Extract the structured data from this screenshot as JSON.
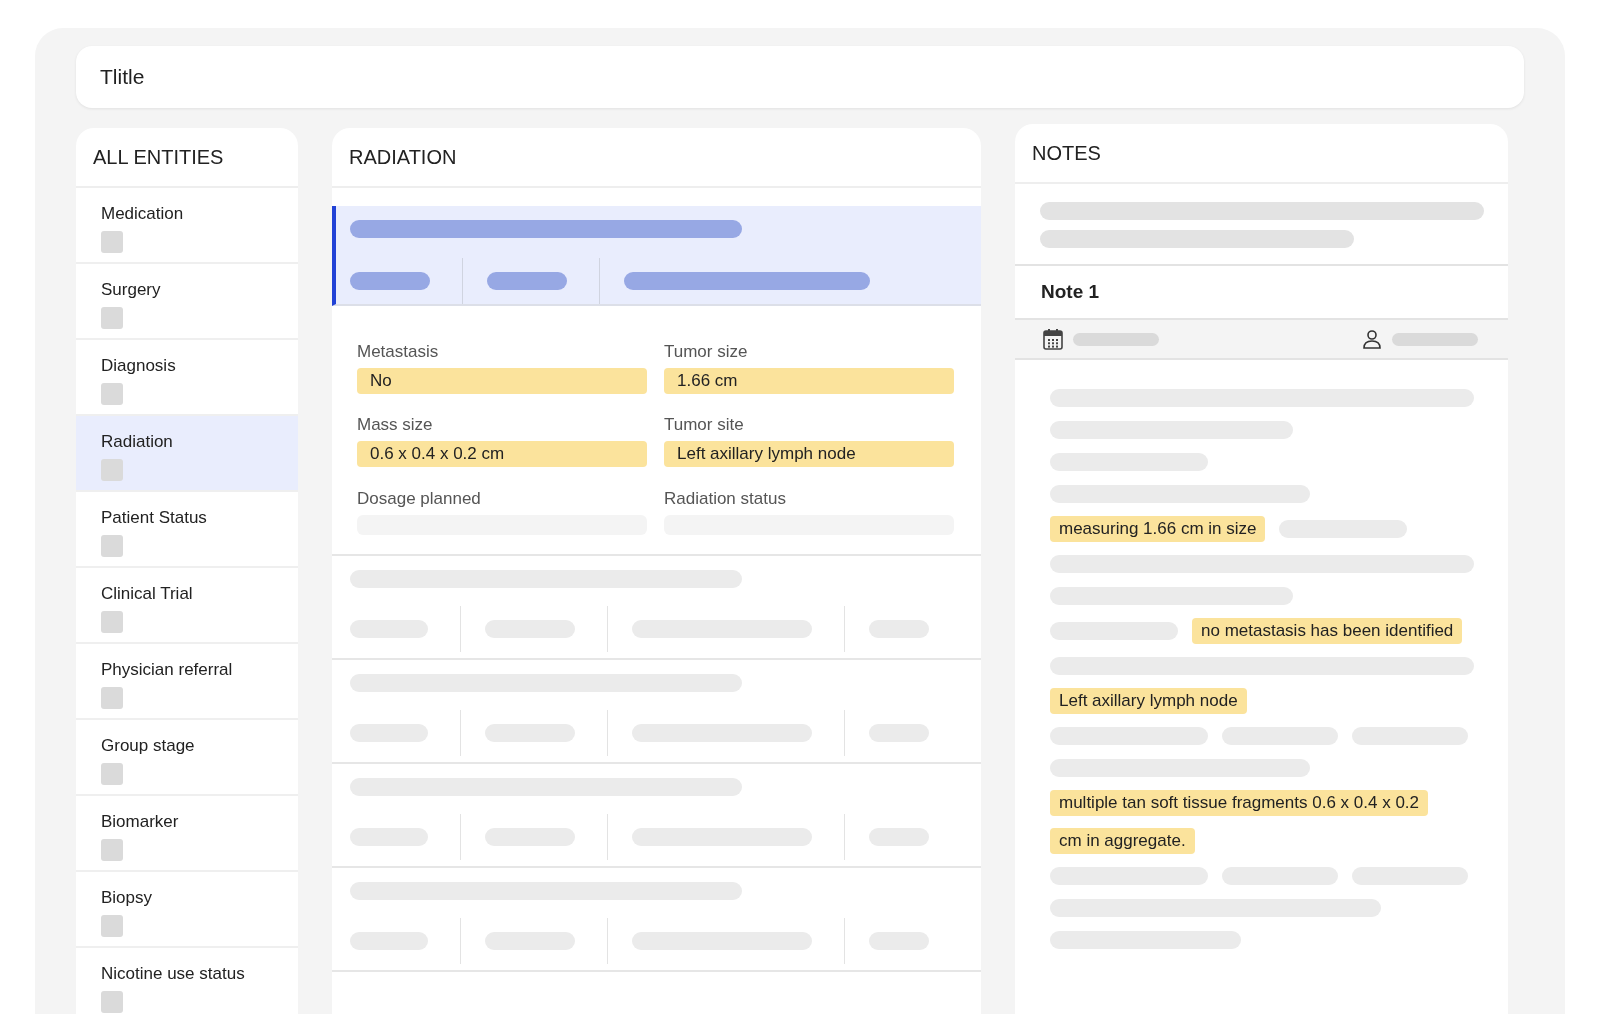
{
  "title": "Tlitle",
  "sidebar": {
    "heading": "ALL ENTITIES",
    "items": [
      {
        "label": "Medication",
        "selected": false
      },
      {
        "label": "Surgery",
        "selected": false
      },
      {
        "label": "Diagnosis",
        "selected": false
      },
      {
        "label": "Radiation",
        "selected": true
      },
      {
        "label": "Patient Status",
        "selected": false
      },
      {
        "label": "Clinical Trial",
        "selected": false
      },
      {
        "label": "Physician referral",
        "selected": false
      },
      {
        "label": "Group stage",
        "selected": false
      },
      {
        "label": "Biomarker",
        "selected": false
      },
      {
        "label": "Biopsy",
        "selected": false
      },
      {
        "label": "Nicotine use status",
        "selected": false
      }
    ]
  },
  "detail": {
    "heading": "RADIATION",
    "fields": [
      {
        "label": "Metastasis",
        "value": "No"
      },
      {
        "label": "Tumor size",
        "value": "1.66 cm"
      },
      {
        "label": "Mass size",
        "value": "0.6 x 0.4 x 0.2 cm"
      },
      {
        "label": "Tumor site",
        "value": "Left axillary lymph node"
      },
      {
        "label": "Dosage planned"
      },
      {
        "label": "Radiation status"
      }
    ]
  },
  "notes": {
    "heading": "NOTES",
    "note_title": "Note 1",
    "highlights": [
      "measuring 1.66 cm in size",
      "no metastasis has been identified",
      "Left axillary lymph node",
      "multiple tan soft tissue fragments 0.6 x 0.4 x 0.2",
      "cm in aggregate."
    ]
  }
}
